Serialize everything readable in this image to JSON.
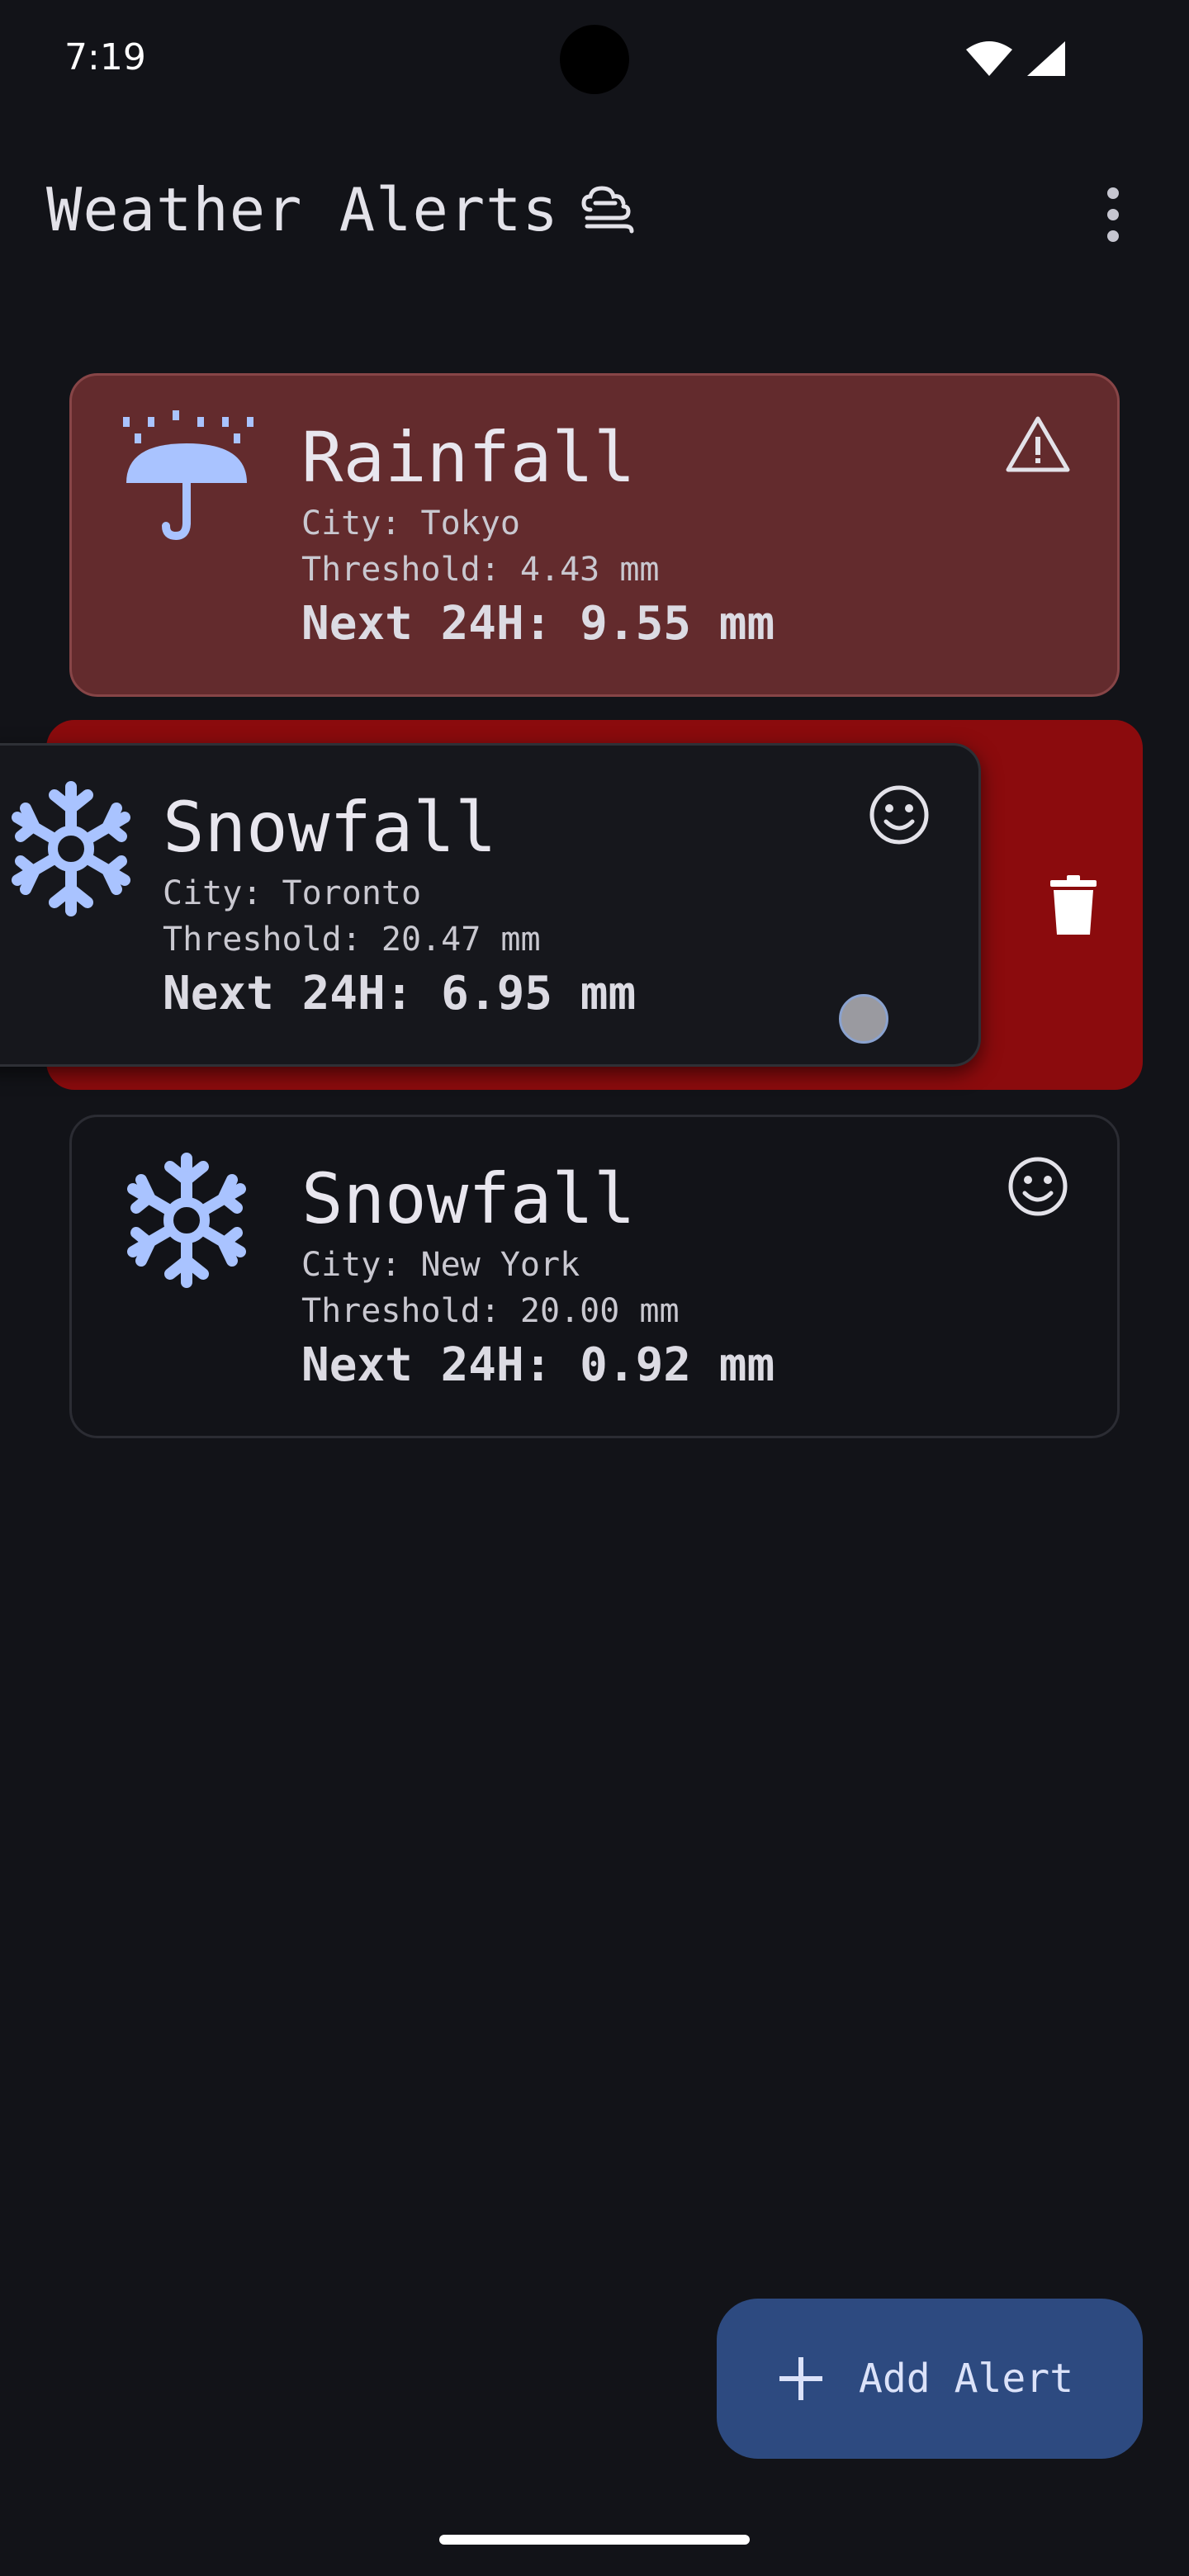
{
  "status_bar": {
    "time": "7:19"
  },
  "app_bar": {
    "title": "Weather Alerts",
    "title_icon": "wind-cloud-icon",
    "menu_icon": "more-vert-icon"
  },
  "alerts": [
    {
      "type": "Rainfall",
      "icon": "umbrella-rain-icon",
      "city": "City: Tokyo",
      "threshold": "Threshold: 4.43 mm",
      "next24h": "Next 24H: 9.55 mm",
      "status_icon": "warning-icon",
      "state": "triggered"
    },
    {
      "type": "Snowfall",
      "icon": "snowflake-icon",
      "city": "City: Toronto",
      "threshold": "Threshold: 20.47 mm",
      "next24h": "Next 24H: 6.95 mm",
      "status_icon": "smile-icon",
      "state": "swiping-to-delete"
    },
    {
      "type": "Snowfall",
      "icon": "snowflake-icon",
      "city": "City: New York",
      "threshold": "Threshold: 20.00 mm",
      "next24h": "Next 24H: 0.92 mm",
      "status_icon": "smile-icon",
      "state": "normal"
    }
  ],
  "fab": {
    "label": "Add Alert",
    "icon": "plus-icon"
  },
  "colors": {
    "background": "#121318",
    "alert_card": "#632b2d",
    "delete_background": "#8b0b0d",
    "weather_icon": "#a9c3ff",
    "fab": "#2d4a80"
  }
}
